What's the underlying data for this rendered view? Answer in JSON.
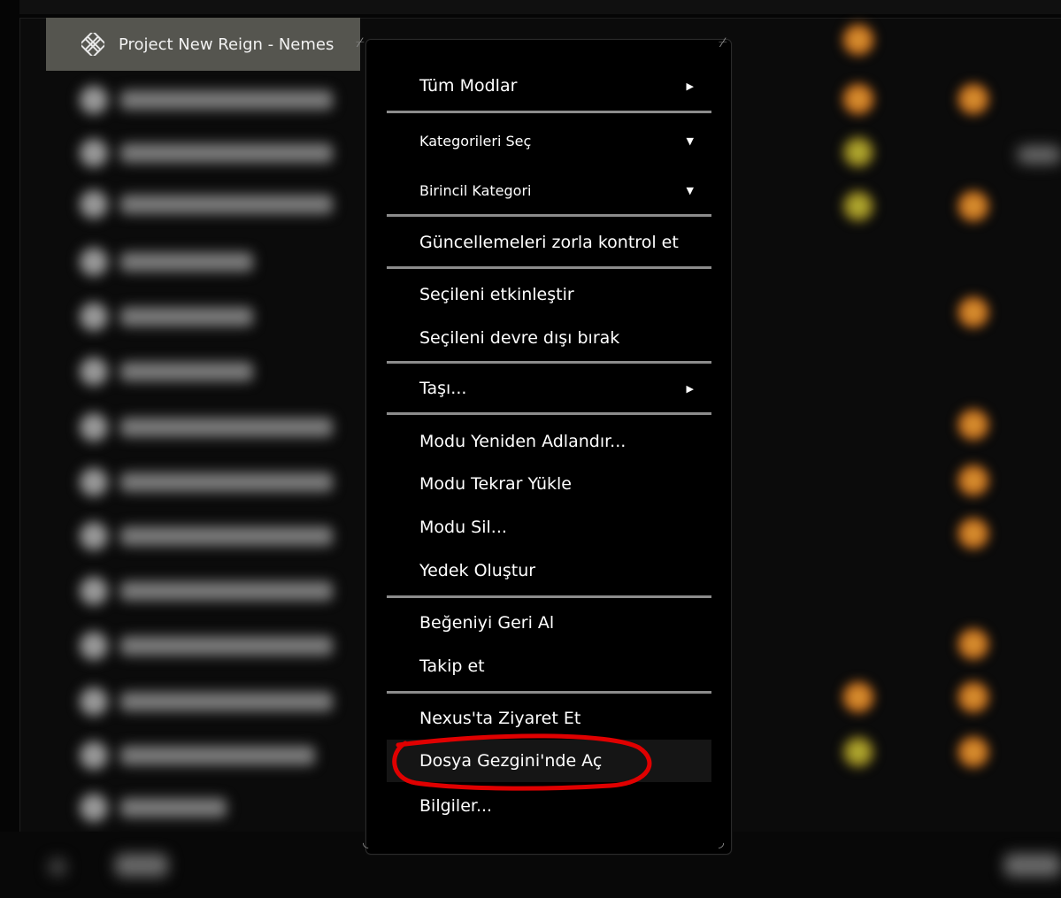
{
  "background": {
    "selected_mod": "Project New Reign - Nemes"
  },
  "context_menu": {
    "items": [
      {
        "label": "Tüm Modlar",
        "arrow": "▶"
      },
      {
        "label": "Kategorileri Seç",
        "arrow": "▼"
      },
      {
        "label": "Birincil Kategori",
        "arrow": "▼"
      },
      {
        "label": "Güncellemeleri zorla kontrol et"
      },
      {
        "label": "Seçileni etkinleştir"
      },
      {
        "label": "Seçileni devre dışı bırak"
      },
      {
        "label": "Taşı...",
        "arrow": "▶"
      },
      {
        "label": "Modu Yeniden Adlandır..."
      },
      {
        "label": "Modu Tekrar Yükle"
      },
      {
        "label": "Modu Sil..."
      },
      {
        "label": "Yedek Oluştur"
      },
      {
        "label": "Beğeniyi Geri Al"
      },
      {
        "label": "Takip et"
      },
      {
        "label": "Nexus'ta Ziyaret Et"
      },
      {
        "label": "Dosya Gezgini'nde Aç"
      },
      {
        "label": "Bilgiler..."
      }
    ]
  },
  "colors": {
    "menu_bg": "#000000",
    "separator": "#8c8c8c",
    "annotation": "#e00000",
    "selected_row": "#55554f"
  }
}
